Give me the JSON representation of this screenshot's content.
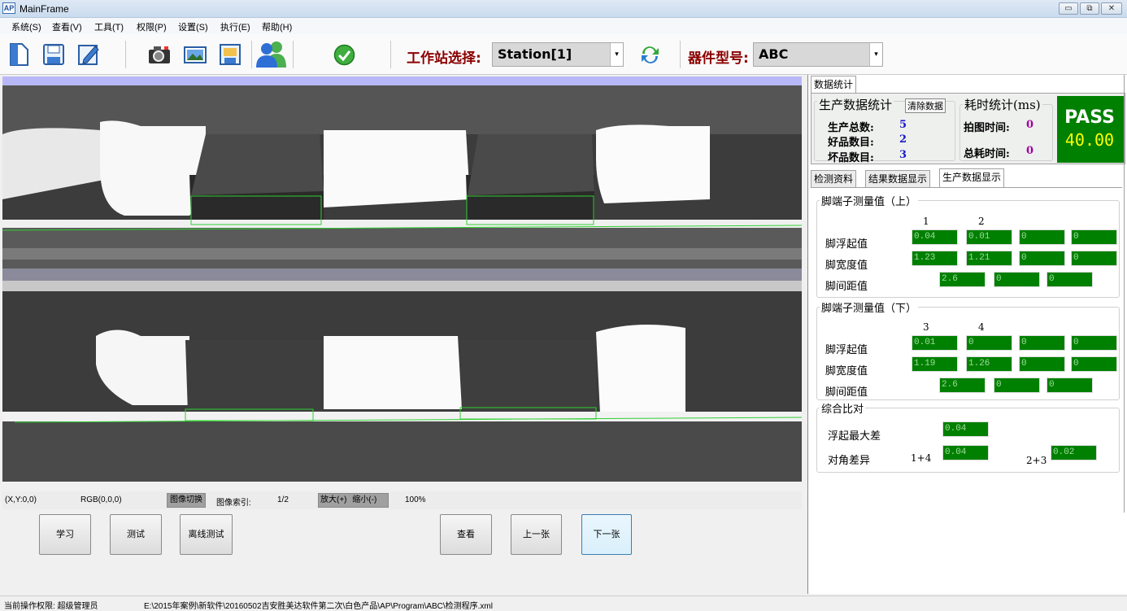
{
  "window": {
    "title": "MainFrame",
    "app_icon": "AP",
    "min_label": "▭",
    "max_label": "⧉",
    "close_label": "✕"
  },
  "menu": [
    "系统(S)",
    "查看(V)",
    "工具(T)",
    "权限(P)",
    "设置(S)",
    "执行(E)",
    "帮助(H)"
  ],
  "toolbar": {
    "station_label": "工作站选择:",
    "station_value": "Station[1]",
    "device_label": "器件型号:",
    "device_value": "ABC",
    "dropdown_arrow": "▾",
    "icons": [
      "new-document-icon",
      "save-icon",
      "edit-icon",
      "camera-icon",
      "image-icon",
      "save-image-icon",
      "users-icon",
      "check-icon",
      "refresh-icon"
    ]
  },
  "status_row": {
    "coord": "(X,Y:0,0)",
    "rgb": "RGB(0,0,0)",
    "switch_label": "图像切换",
    "index_label": "图像索引:",
    "index_value": "1/2",
    "zoom_in": "放大(+)",
    "zoom_out": "缩小(-)",
    "zoom_value": "100%"
  },
  "buttons": {
    "learn": "学习",
    "test": "测试",
    "offline_test": "离线测试",
    "view": "查看",
    "prev": "上一张",
    "next": "下一张"
  },
  "right": {
    "top_tab": "数据统计",
    "production_title": "生产数据统计",
    "clear_button": "清除数据",
    "total_label": "生产总数:",
    "total_value": "5",
    "good_label": "好品数目:",
    "good_value": "2",
    "bad_label": "坏品数目:",
    "bad_value": "3",
    "time_title": "耗时统计(ms)",
    "capture_label": "拍图时间:",
    "capture_value": "0",
    "total_time_label": "总耗时间:",
    "total_time_value": "0",
    "result": "PASS",
    "score": "40.00",
    "tabs": [
      "检测资料",
      "结果数据显示",
      "生产数据显示"
    ],
    "upper": {
      "title": "脚端子测量值（上）",
      "cols": [
        "1",
        "2"
      ],
      "float_label": "脚浮起值",
      "float": [
        "0.04",
        "0.01",
        "0",
        "0"
      ],
      "width_label": "脚宽度值",
      "width": [
        "1.23",
        "1.21",
        "0",
        "0"
      ],
      "pitch_label": "脚间距值",
      "pitch": [
        "2.6",
        "0",
        "0"
      ]
    },
    "lower": {
      "title": "脚端子测量值（下）",
      "cols": [
        "3",
        "4"
      ],
      "float_label": "脚浮起值",
      "float": [
        "0.01",
        "0",
        "0",
        "0"
      ],
      "width_label": "脚宽度值",
      "width": [
        "1.19",
        "1.26",
        "0",
        "0"
      ],
      "pitch_label": "脚间距值",
      "pitch": [
        "2.6",
        "0",
        "0"
      ]
    },
    "compare": {
      "title": "综合比对",
      "max_float_label": "浮起最大差",
      "max_float": "0.04",
      "diag_label": "对角差异",
      "pair1": "1+4",
      "pair1_value": "0.04",
      "pair2": "2+3",
      "pair2_value": "0.02"
    }
  },
  "statusbar": {
    "permission": "当前操作权限: 超级管理员",
    "path": "E:\\2015年案例\\新软件\\20160502吉安胜美达软件第二次\\白色产品\\AP\\Program\\ABC\\检测程序.xml"
  },
  "colors": {
    "pass_bg": "#008000",
    "pass_score": "#ffff00",
    "value_green": "#008000",
    "toolbar_label": "#8b0000"
  }
}
